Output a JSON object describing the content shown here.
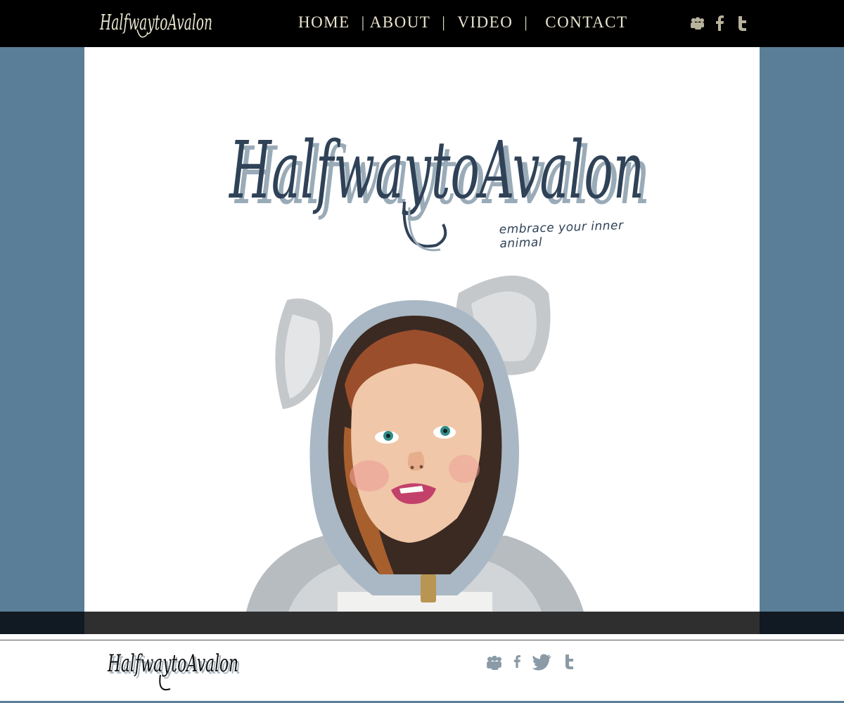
{
  "header": {
    "logo_text": "HalfwaytoAvalon",
    "nav": [
      {
        "label": "HOME"
      },
      {
        "label": "ABOUT"
      },
      {
        "label": "VIDEO"
      },
      {
        "label": "CONTACT"
      }
    ],
    "separator": "|",
    "social_icons": [
      "myspace-icon",
      "facebook-icon",
      "tumblr-icon"
    ],
    "colors": {
      "background": "#000000",
      "nav_text": "#eae5cf"
    }
  },
  "hero": {
    "logo_text": "HalfwaytoAvalon",
    "tagline": "embrace your inner animal",
    "artwork": "painting of child wearing grey koala-ear hoodie",
    "colors": {
      "side_background": "#5a7e97",
      "logo": "#2f4257",
      "logo_shadow": "#9aabb8"
    }
  },
  "footer": {
    "logo_text": "HalfwaytoAvalon",
    "social_icons": [
      "myspace-icon",
      "facebook-icon",
      "twitter-icon",
      "tumblr-icon"
    ],
    "colors": {
      "strip": "#2f2f2f",
      "icons": "#8a9aa6"
    }
  }
}
